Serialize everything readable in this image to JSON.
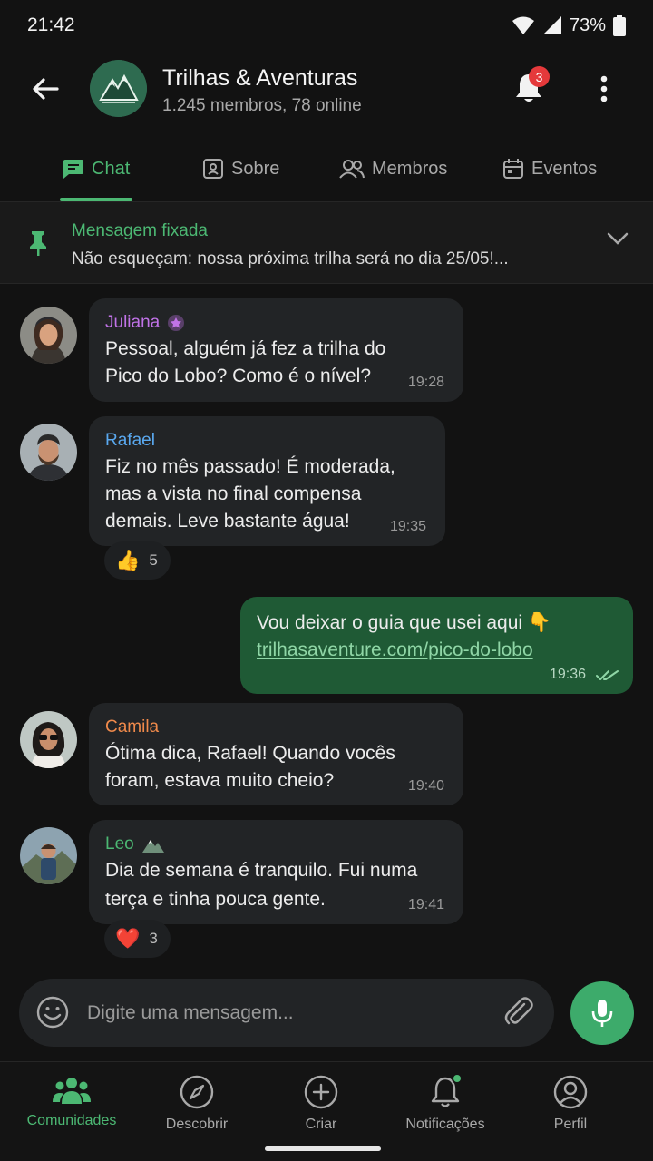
{
  "status_bar": {
    "time": "21:42",
    "battery": "73%"
  },
  "header": {
    "group_name": "Trilhas & Aventuras",
    "group_subtitle": "1.245 membros, 78 online",
    "notification_count": "3"
  },
  "tabs": [
    {
      "label": "Chat",
      "active": true
    },
    {
      "label": "Sobre",
      "active": false
    },
    {
      "label": "Membros",
      "active": false
    },
    {
      "label": "Eventos",
      "active": false
    }
  ],
  "pinned": {
    "title": "Mensagem fixada",
    "text": "Não esqueçam: nossa próxima trilha será no dia 25/05!..."
  },
  "messages": [
    {
      "sender": "Juliana",
      "sender_color": "#C173E8",
      "lines": [
        "Pessoal, alguém já fez a trilha do",
        "Pico do Lobo? Como é o nível?"
      ],
      "time": "19:28"
    },
    {
      "sender": "Rafael",
      "sender_color": "#5AA9F0",
      "lines": [
        "Fiz no mês passado! É moderada,",
        "mas a vista no final compensa",
        "demais. Leve bastante água!"
      ],
      "time": "19:35",
      "reaction_emoji": "👍",
      "reaction_count": "5"
    },
    {
      "sender": "",
      "lines": [
        "Vou deixar o guia que usei aqui 👇"
      ],
      "link": "trilhasaventure.com/pico-do-lobo",
      "time": "19:36",
      "outgoing": true
    },
    {
      "sender": "Camila",
      "sender_color": "#F08A4B",
      "lines": [
        "Ótima dica, Rafael! Quando vocês",
        "foram, estava muito cheio?"
      ],
      "time": "19:40"
    },
    {
      "sender": "Leo",
      "sender_color": "#4CB873",
      "lines": [
        "Dia de semana é tranquilo. Fui numa",
        "terça e tinha pouca gente."
      ],
      "time": "19:41",
      "reaction_emoji": "❤️",
      "reaction_count": "3"
    }
  ],
  "composer": {
    "placeholder": "Digite uma mensagem..."
  },
  "bottom_nav": [
    {
      "label": "Comunidades",
      "active": true
    },
    {
      "label": "Descobrir",
      "active": false
    },
    {
      "label": "Criar",
      "active": false
    },
    {
      "label": "Notificações",
      "active": false
    },
    {
      "label": "Perfil",
      "active": false
    }
  ],
  "colors": {
    "accent": "#4CB873",
    "background": "#121212",
    "bubble_in": "#222426",
    "bubble_out": "#1F5A35",
    "badge": "#E5393B"
  }
}
